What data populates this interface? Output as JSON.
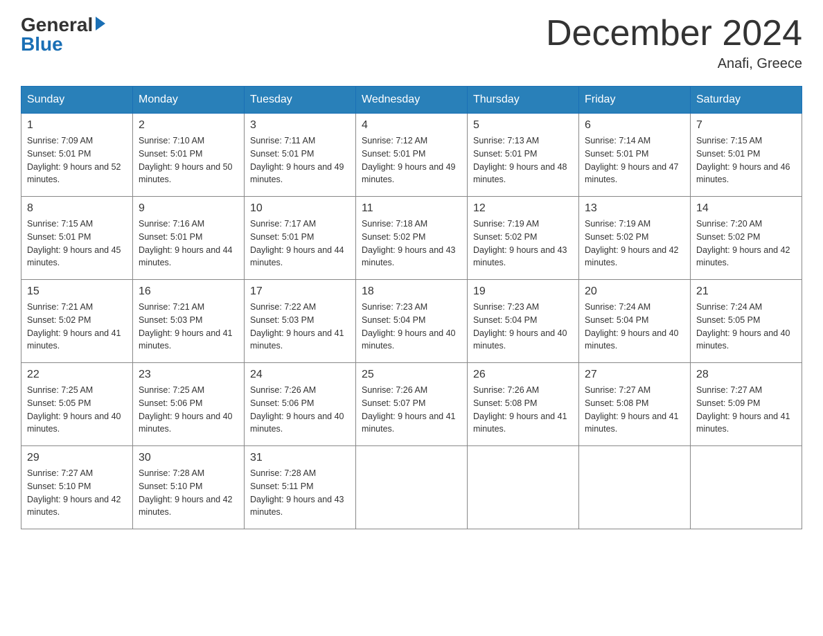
{
  "header": {
    "logo_general": "General",
    "logo_blue": "Blue",
    "month_title": "December 2024",
    "location": "Anafi, Greece"
  },
  "days_of_week": [
    "Sunday",
    "Monday",
    "Tuesday",
    "Wednesday",
    "Thursday",
    "Friday",
    "Saturday"
  ],
  "weeks": [
    [
      {
        "day": "1",
        "sunrise": "7:09 AM",
        "sunset": "5:01 PM",
        "daylight": "9 hours and 52 minutes."
      },
      {
        "day": "2",
        "sunrise": "7:10 AM",
        "sunset": "5:01 PM",
        "daylight": "9 hours and 50 minutes."
      },
      {
        "day": "3",
        "sunrise": "7:11 AM",
        "sunset": "5:01 PM",
        "daylight": "9 hours and 49 minutes."
      },
      {
        "day": "4",
        "sunrise": "7:12 AM",
        "sunset": "5:01 PM",
        "daylight": "9 hours and 49 minutes."
      },
      {
        "day": "5",
        "sunrise": "7:13 AM",
        "sunset": "5:01 PM",
        "daylight": "9 hours and 48 minutes."
      },
      {
        "day": "6",
        "sunrise": "7:14 AM",
        "sunset": "5:01 PM",
        "daylight": "9 hours and 47 minutes."
      },
      {
        "day": "7",
        "sunrise": "7:15 AM",
        "sunset": "5:01 PM",
        "daylight": "9 hours and 46 minutes."
      }
    ],
    [
      {
        "day": "8",
        "sunrise": "7:15 AM",
        "sunset": "5:01 PM",
        "daylight": "9 hours and 45 minutes."
      },
      {
        "day": "9",
        "sunrise": "7:16 AM",
        "sunset": "5:01 PM",
        "daylight": "9 hours and 44 minutes."
      },
      {
        "day": "10",
        "sunrise": "7:17 AM",
        "sunset": "5:01 PM",
        "daylight": "9 hours and 44 minutes."
      },
      {
        "day": "11",
        "sunrise": "7:18 AM",
        "sunset": "5:02 PM",
        "daylight": "9 hours and 43 minutes."
      },
      {
        "day": "12",
        "sunrise": "7:19 AM",
        "sunset": "5:02 PM",
        "daylight": "9 hours and 43 minutes."
      },
      {
        "day": "13",
        "sunrise": "7:19 AM",
        "sunset": "5:02 PM",
        "daylight": "9 hours and 42 minutes."
      },
      {
        "day": "14",
        "sunrise": "7:20 AM",
        "sunset": "5:02 PM",
        "daylight": "9 hours and 42 minutes."
      }
    ],
    [
      {
        "day": "15",
        "sunrise": "7:21 AM",
        "sunset": "5:02 PM",
        "daylight": "9 hours and 41 minutes."
      },
      {
        "day": "16",
        "sunrise": "7:21 AM",
        "sunset": "5:03 PM",
        "daylight": "9 hours and 41 minutes."
      },
      {
        "day": "17",
        "sunrise": "7:22 AM",
        "sunset": "5:03 PM",
        "daylight": "9 hours and 41 minutes."
      },
      {
        "day": "18",
        "sunrise": "7:23 AM",
        "sunset": "5:04 PM",
        "daylight": "9 hours and 40 minutes."
      },
      {
        "day": "19",
        "sunrise": "7:23 AM",
        "sunset": "5:04 PM",
        "daylight": "9 hours and 40 minutes."
      },
      {
        "day": "20",
        "sunrise": "7:24 AM",
        "sunset": "5:04 PM",
        "daylight": "9 hours and 40 minutes."
      },
      {
        "day": "21",
        "sunrise": "7:24 AM",
        "sunset": "5:05 PM",
        "daylight": "9 hours and 40 minutes."
      }
    ],
    [
      {
        "day": "22",
        "sunrise": "7:25 AM",
        "sunset": "5:05 PM",
        "daylight": "9 hours and 40 minutes."
      },
      {
        "day": "23",
        "sunrise": "7:25 AM",
        "sunset": "5:06 PM",
        "daylight": "9 hours and 40 minutes."
      },
      {
        "day": "24",
        "sunrise": "7:26 AM",
        "sunset": "5:06 PM",
        "daylight": "9 hours and 40 minutes."
      },
      {
        "day": "25",
        "sunrise": "7:26 AM",
        "sunset": "5:07 PM",
        "daylight": "9 hours and 41 minutes."
      },
      {
        "day": "26",
        "sunrise": "7:26 AM",
        "sunset": "5:08 PM",
        "daylight": "9 hours and 41 minutes."
      },
      {
        "day": "27",
        "sunrise": "7:27 AM",
        "sunset": "5:08 PM",
        "daylight": "9 hours and 41 minutes."
      },
      {
        "day": "28",
        "sunrise": "7:27 AM",
        "sunset": "5:09 PM",
        "daylight": "9 hours and 41 minutes."
      }
    ],
    [
      {
        "day": "29",
        "sunrise": "7:27 AM",
        "sunset": "5:10 PM",
        "daylight": "9 hours and 42 minutes."
      },
      {
        "day": "30",
        "sunrise": "7:28 AM",
        "sunset": "5:10 PM",
        "daylight": "9 hours and 42 minutes."
      },
      {
        "day": "31",
        "sunrise": "7:28 AM",
        "sunset": "5:11 PM",
        "daylight": "9 hours and 43 minutes."
      },
      null,
      null,
      null,
      null
    ]
  ]
}
